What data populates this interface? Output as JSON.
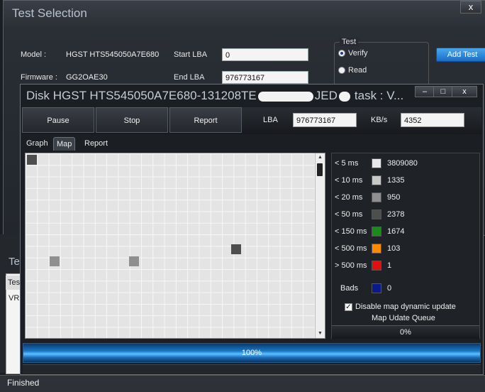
{
  "bg_window": {
    "title": "Test Selection",
    "close": "x",
    "model_label": "Model :",
    "model_value": "HGST HTS545050A7E680",
    "firmware_label": "Firmware :",
    "firmware_value": "GG2OAE30",
    "start_lba_label": "Start LBA",
    "start_lba_value": "0",
    "end_lba_label": "End LBA",
    "end_lba_value": "976773167",
    "test_group_title": "Test",
    "radio_verify": "Verify",
    "radio_read": "Read",
    "add_test": "Add Test",
    "lower_title": "Te",
    "lower_header": "Tes",
    "lower_row": "VR"
  },
  "disk_window": {
    "title": "Disk HGST HTS545050A7E680-131208TE",
    "title_suffix": "JED",
    "title_task": "task : V...",
    "ctrl_min": "–",
    "ctrl_max": "□",
    "ctrl_close": "x",
    "buttons": {
      "pause": "Pause",
      "stop": "Stop",
      "report": "Report"
    },
    "lba_label": "LBA",
    "lba_value": "976773167",
    "kbs_label": "KB/s",
    "kbs_value": "4352",
    "tabs": [
      "Graph",
      "Map",
      "Report"
    ],
    "active_tab": "Map",
    "legend": [
      {
        "label": "< 5 ms",
        "count": "3809080",
        "color": "#e8e8e8"
      },
      {
        "label": "< 10 ms",
        "count": "1335",
        "color": "#c8c8c8"
      },
      {
        "label": "< 20 ms",
        "count": "950",
        "color": "#8f8f8f"
      },
      {
        "label": "< 50 ms",
        "count": "2378",
        "color": "#4e4e4e"
      },
      {
        "label": "< 150 ms",
        "count": "1674",
        "color": "#1a8a1a"
      },
      {
        "label": "< 500 ms",
        "count": "103",
        "color": "#ff8a00"
      },
      {
        "label": "> 500 ms",
        "count": "1",
        "color": "#e01010"
      }
    ],
    "bads_label": "Bads",
    "bads_count": "0",
    "bads_color": "#0a1a8a",
    "disable_map_update": "Disable map dynamic update",
    "map_queue_label": "Map Udate Queue",
    "map_queue_value": "0%",
    "progress": 1.0,
    "progress_text": "100%"
  },
  "status_bar": {
    "text": "Finished"
  }
}
